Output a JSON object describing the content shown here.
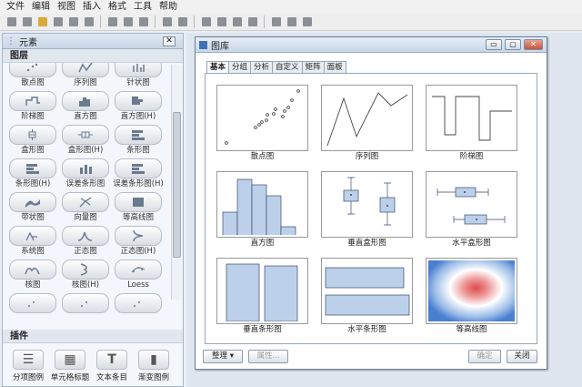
{
  "menu": [
    "文件",
    "编辑",
    "视图",
    "插入",
    "格式",
    "工具",
    "帮助"
  ],
  "toolbar_groups": [
    6,
    3,
    2,
    4,
    3
  ],
  "left_panel": {
    "title": "元素",
    "close_glyph": "✕",
    "section_title": "图层",
    "elements": [
      {
        "label": "散点图",
        "icon": "scatter-icon"
      },
      {
        "label": "序列图",
        "icon": "sequence-icon"
      },
      {
        "label": "针状图",
        "icon": "needle-icon"
      },
      {
        "label": "阶梯图",
        "icon": "step-icon"
      },
      {
        "label": "直方图",
        "icon": "histogram-icon"
      },
      {
        "label": "直方图(H)",
        "icon": "histogram-h-icon"
      },
      {
        "label": "盒形图",
        "icon": "box-icon"
      },
      {
        "label": "盒形图(H)",
        "icon": "box-h-icon"
      },
      {
        "label": "条形图",
        "icon": "bar-icon"
      },
      {
        "label": "条形图(H)",
        "icon": "bar-h-icon"
      },
      {
        "label": "误差条形图",
        "icon": "error-bar-icon"
      },
      {
        "label": "误差条形图(H)",
        "icon": "error-bar-h-icon"
      },
      {
        "label": "带状图",
        "icon": "band-icon"
      },
      {
        "label": "向量图",
        "icon": "vector-icon"
      },
      {
        "label": "等高线图",
        "icon": "contour-icon"
      },
      {
        "label": "系统图",
        "icon": "system-icon"
      },
      {
        "label": "正态图",
        "icon": "normal-icon"
      },
      {
        "label": "正态图(H)",
        "icon": "normal-h-icon"
      },
      {
        "label": "核图",
        "icon": "kernel-icon"
      },
      {
        "label": "核图(H)",
        "icon": "kernel-h-icon"
      },
      {
        "label": "Loess",
        "icon": "loess-icon"
      },
      {
        "label": "",
        "icon": "more-icon"
      },
      {
        "label": "",
        "icon": "more-icon"
      },
      {
        "label": "",
        "icon": "more-icon"
      }
    ],
    "plugin_title": "插件",
    "plugins": [
      {
        "label": "分项图例",
        "glyph": "☰"
      },
      {
        "label": "单元格标题",
        "glyph": "▦"
      },
      {
        "label": "文本条目",
        "glyph": "T"
      },
      {
        "label": "渐变图例",
        "glyph": "▮"
      }
    ]
  },
  "dialog": {
    "title": "图库",
    "window_buttons": [
      "▭",
      "▢",
      "✕"
    ],
    "tabs": [
      "基本",
      "分组",
      "分析",
      "自定义",
      "矩阵",
      "面板"
    ],
    "active_tab": 0,
    "gallery": [
      {
        "label": "散点图",
        "kind": "scatter"
      },
      {
        "label": "序列图",
        "kind": "series"
      },
      {
        "label": "阶梯图",
        "kind": "step"
      },
      {
        "label": "直方图",
        "kind": "histogram"
      },
      {
        "label": "垂直盒形图",
        "kind": "vbox"
      },
      {
        "label": "水平盒形图",
        "kind": "hbox"
      },
      {
        "label": "垂直条形图",
        "kind": "vbar"
      },
      {
        "label": "水平条形图",
        "kind": "hbar"
      },
      {
        "label": "等高线图",
        "kind": "contour"
      }
    ],
    "manage_label": "整理",
    "manage_arrow": "▾",
    "properties_label": "属性...",
    "ok_label": "确定",
    "close_label": "关闭"
  },
  "colors": {
    "bar_fill": "#bcd0ea",
    "bar_stroke": "#3a4a6a",
    "contour_hot": "#e04a4a",
    "contour_cool": "#4a7fd0"
  }
}
